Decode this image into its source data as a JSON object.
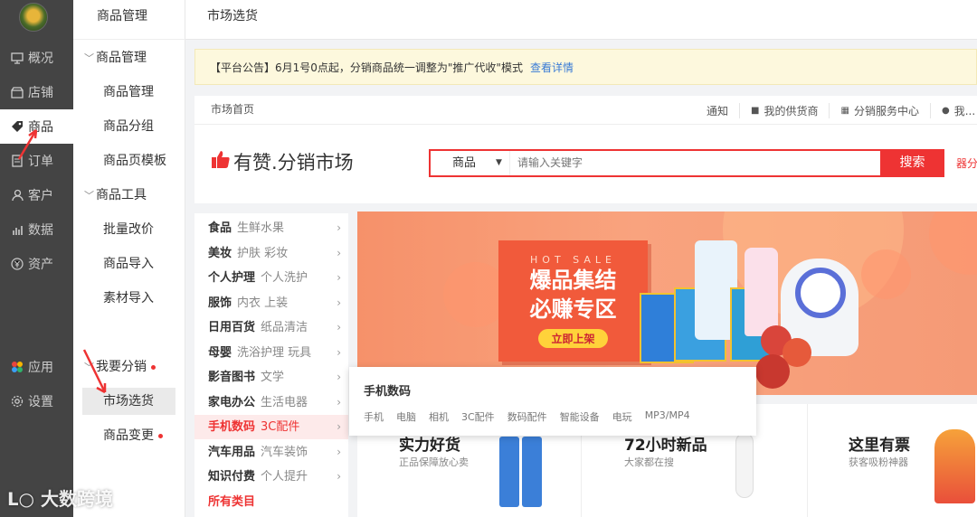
{
  "sidebar": {
    "items": [
      {
        "label": "概况",
        "icon": "monitor-icon"
      },
      {
        "label": "店铺",
        "icon": "store-icon"
      },
      {
        "label": "商品",
        "icon": "tag-icon"
      },
      {
        "label": "订单",
        "icon": "order-icon"
      },
      {
        "label": "客户",
        "icon": "user-icon"
      },
      {
        "label": "数据",
        "icon": "chart-icon"
      },
      {
        "label": "资产",
        "icon": "yen-icon"
      },
      {
        "label": "应用",
        "icon": "apps-icon"
      },
      {
        "label": "设置",
        "icon": "gear-icon"
      }
    ]
  },
  "subnav": {
    "title": "商品管理",
    "group1": "商品管理",
    "group1_items": [
      "商品管理",
      "商品分组",
      "商品页模板"
    ],
    "group2": "商品工具",
    "group2_items": [
      "批量改价",
      "商品导入",
      "素材导入"
    ],
    "group3": "我要分销",
    "group3_items": [
      "市场选货",
      "商品变更"
    ]
  },
  "header": {
    "breadcrumb": "市场选货"
  },
  "notice": {
    "text": "【平台公告】6月1号0点起，分销商品统一调整为\"推广代收\"模式",
    "link": "查看详情"
  },
  "market_nav": {
    "home": "市场首页",
    "links": [
      "通知",
      "我的供货商",
      "分销服务中心",
      "我..."
    ]
  },
  "logo": {
    "text": "有赞.分销市场"
  },
  "search": {
    "scope": "商品",
    "placeholder": "请输入关键字",
    "button": "搜索",
    "side_link": "分"
  },
  "categories": [
    {
      "name": "食品",
      "subs": "生鲜水果"
    },
    {
      "name": "美妆",
      "subs": "护肤  彩妆"
    },
    {
      "name": "个人护理",
      "subs": "个人洗护"
    },
    {
      "name": "服饰",
      "subs": "内衣  上装"
    },
    {
      "name": "日用百货",
      "subs": "纸品清洁"
    },
    {
      "name": "母婴",
      "subs": "洗浴护理  玩具"
    },
    {
      "name": "影音图书",
      "subs": "文学"
    },
    {
      "name": "家电办公",
      "subs": "生活电器"
    },
    {
      "name": "手机数码",
      "subs": "3C配件"
    },
    {
      "name": "汽车用品",
      "subs": "汽车装饰"
    },
    {
      "name": "知识付费",
      "subs": "个人提升"
    }
  ],
  "all_categories": "所有类目",
  "banner": {
    "hot_sale": "HOT SALE",
    "line1": "爆品集结",
    "line2": "必赚专区",
    "cta": "立即上架"
  },
  "popup": {
    "title": "手机数码",
    "items": [
      "手机",
      "电脑",
      "相机",
      "3C配件",
      "数码配件",
      "智能设备",
      "电玩",
      "MP3/MP4"
    ]
  },
  "cards": [
    {
      "title": "实力好货",
      "sub": "正品保障放心卖"
    },
    {
      "title": "72小时新品",
      "sub": "大家都在搜"
    },
    {
      "title": "这里有票",
      "sub": "获客吸粉神器"
    }
  ],
  "watermark": "大数跨境",
  "colors": {
    "brand_red": "#e33333",
    "sidebar_dark": "#444444",
    "notice_bg": "#fdf8dd"
  }
}
